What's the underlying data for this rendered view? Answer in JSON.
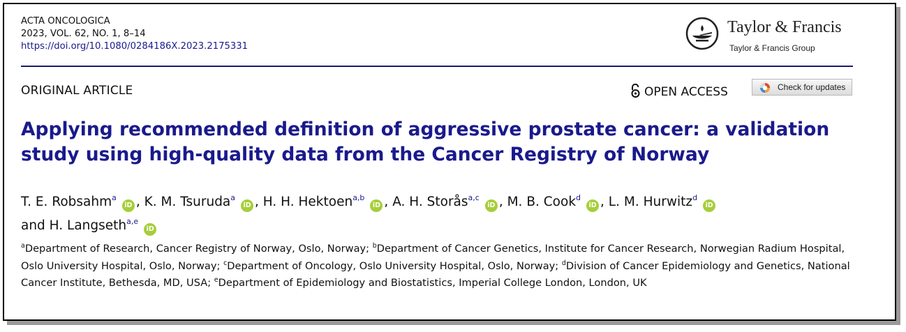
{
  "journal": {
    "name": "ACTA ONCOLOGICA",
    "volume": "2023, VOL. 62, NO. 1, 8–14",
    "doi": "https://doi.org/10.1080/0284186X.2023.2175331"
  },
  "publisher": {
    "name": "Taylor & Francis",
    "group": "Taylor & Francis Group",
    "logo_icon": "lamp-logo-icon"
  },
  "article_type": "ORIGINAL ARTICLE",
  "open_access": {
    "icon": "open-lock-icon",
    "label": "OPEN ACCESS"
  },
  "check_updates": {
    "label": "Check for updates",
    "icon": "crossmark-icon"
  },
  "title": "Applying recommended definition of aggressive prostate cancer: a validation study using high-quality data from the Cancer Registry of Norway",
  "authors": [
    {
      "name": "T. E. Robsahm",
      "sup": "a",
      "sep": ", "
    },
    {
      "name": "K. M. Tsuruda",
      "sup": "a",
      "sep": ", "
    },
    {
      "name": "H. H. Hektoen",
      "sup": "a,b",
      "sep": ", "
    },
    {
      "name": "A. H. Storås",
      "sup": "a,c",
      "sep": ", "
    },
    {
      "name": "M. B. Cook",
      "sup": "d",
      "sep": ", "
    },
    {
      "name": "L. M. Hurwitz",
      "sup": "d",
      "sep": ""
    },
    {
      "name": "and H. Langseth",
      "sup": "a,e",
      "sep": ""
    }
  ],
  "orcid_label": "iD",
  "affiliations": [
    {
      "sup": "a",
      "text": "Department of Research, Cancer Registry of Norway, Oslo, Norway; "
    },
    {
      "sup": "b",
      "text": "Department of Cancer Genetics, Institute for Cancer Research, Norwegian Radium Hospital, Oslo University Hospital, Oslo, Norway; "
    },
    {
      "sup": "c",
      "text": "Department of Oncology, Oslo University Hospital, Oslo, Norway; "
    },
    {
      "sup": "d",
      "text": "Division of Cancer Epidemiology and Genetics, National Cancer Institute, Bethesda, MD, USA; "
    },
    {
      "sup": "e",
      "text": "Department of Epidemiology and Biostatistics, Imperial College London, London, UK"
    }
  ],
  "colors": {
    "title": "#1a1a8c",
    "rule": "#1a1a6e",
    "orcid": "#a6ce39"
  }
}
